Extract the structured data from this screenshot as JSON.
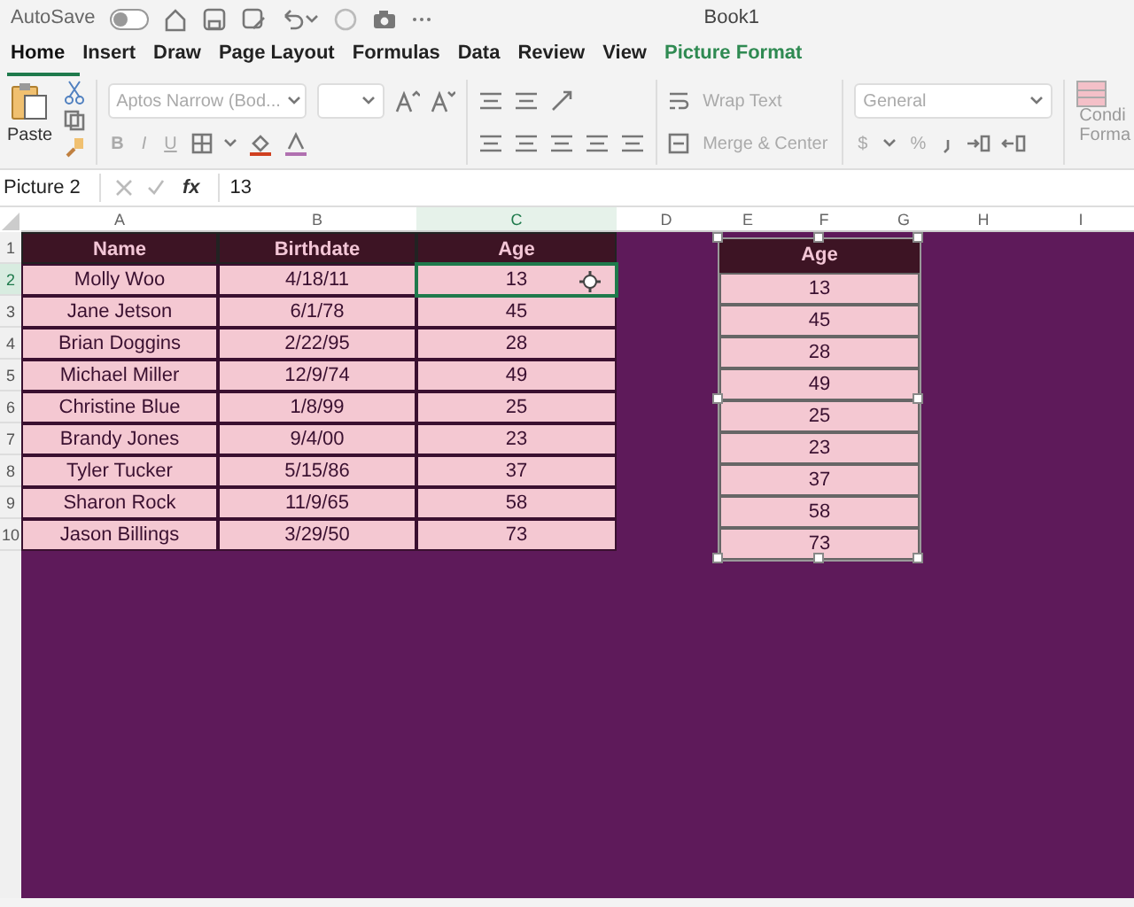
{
  "title_bar": {
    "autosave_label": "AutoSave",
    "autosave_on": false,
    "book_title": "Book1"
  },
  "tabs": [
    {
      "label": "Home",
      "selected": true,
      "kind": "tab"
    },
    {
      "label": "Insert",
      "selected": false,
      "kind": "tab"
    },
    {
      "label": "Draw",
      "selected": false,
      "kind": "tab"
    },
    {
      "label": "Page Layout",
      "selected": false,
      "kind": "tab"
    },
    {
      "label": "Formulas",
      "selected": false,
      "kind": "tab"
    },
    {
      "label": "Data",
      "selected": false,
      "kind": "tab"
    },
    {
      "label": "Review",
      "selected": false,
      "kind": "tab"
    },
    {
      "label": "View",
      "selected": false,
      "kind": "tab"
    },
    {
      "label": "Picture Format",
      "selected": false,
      "kind": "contextual"
    }
  ],
  "ribbon": {
    "paste_label": "Paste",
    "font_name": "Aptos Narrow (Bod...",
    "format_buttons": [
      "B",
      "I",
      "U"
    ],
    "wrap_text": "Wrap Text",
    "merge_center": "Merge & Center",
    "number_format": "General",
    "currency": "$",
    "percent": "%",
    "conditional_formatting": [
      "Condi",
      "Forma"
    ]
  },
  "formula_bar": {
    "name_box": "Picture 2",
    "fx": "fx",
    "value": "13"
  },
  "sheet": {
    "columns": [
      "A",
      "B",
      "C",
      "D",
      "E",
      "F",
      "G",
      "H",
      "I"
    ],
    "row_numbers": [
      "1",
      "2",
      "3",
      "4",
      "5",
      "6",
      "7",
      "8",
      "9",
      "10"
    ]
  },
  "table": {
    "columns": [
      "Name",
      "Birthdate",
      "Age"
    ],
    "rows": [
      {
        "cells": [
          {
            "text": "Molly Woo",
            "selected": false
          },
          {
            "text": "4/18/11",
            "selected": false
          },
          {
            "text": "13",
            "selected": true
          }
        ]
      },
      {
        "cells": [
          {
            "text": "Jane Jetson",
            "selected": false
          },
          {
            "text": "6/1/78",
            "selected": false
          },
          {
            "text": "45",
            "selected": false
          }
        ]
      },
      {
        "cells": [
          {
            "text": "Brian Doggins",
            "selected": false
          },
          {
            "text": "2/22/95",
            "selected": false
          },
          {
            "text": "28",
            "selected": false
          }
        ]
      },
      {
        "cells": [
          {
            "text": "Michael Miller",
            "selected": false
          },
          {
            "text": "12/9/74",
            "selected": false
          },
          {
            "text": "49",
            "selected": false
          }
        ]
      },
      {
        "cells": [
          {
            "text": "Christine Blue",
            "selected": false
          },
          {
            "text": "1/8/99",
            "selected": false
          },
          {
            "text": "25",
            "selected": false
          }
        ]
      },
      {
        "cells": [
          {
            "text": "Brandy Jones",
            "selected": false
          },
          {
            "text": "9/4/00",
            "selected": false
          },
          {
            "text": "23",
            "selected": false
          }
        ]
      },
      {
        "cells": [
          {
            "text": "Tyler Tucker",
            "selected": false
          },
          {
            "text": "5/15/86",
            "selected": false
          },
          {
            "text": "37",
            "selected": false
          }
        ]
      },
      {
        "cells": [
          {
            "text": "Sharon Rock",
            "selected": false
          },
          {
            "text": "11/9/65",
            "selected": false
          },
          {
            "text": "58",
            "selected": false
          }
        ]
      },
      {
        "cells": [
          {
            "text": "Jason Billings",
            "selected": false
          },
          {
            "text": "3/29/50",
            "selected": false
          },
          {
            "text": "73",
            "selected": false
          }
        ]
      }
    ]
  },
  "picture": {
    "selected": true,
    "header": "Age",
    "values": [
      "13",
      "45",
      "28",
      "49",
      "25",
      "23",
      "37",
      "58",
      "73"
    ]
  }
}
